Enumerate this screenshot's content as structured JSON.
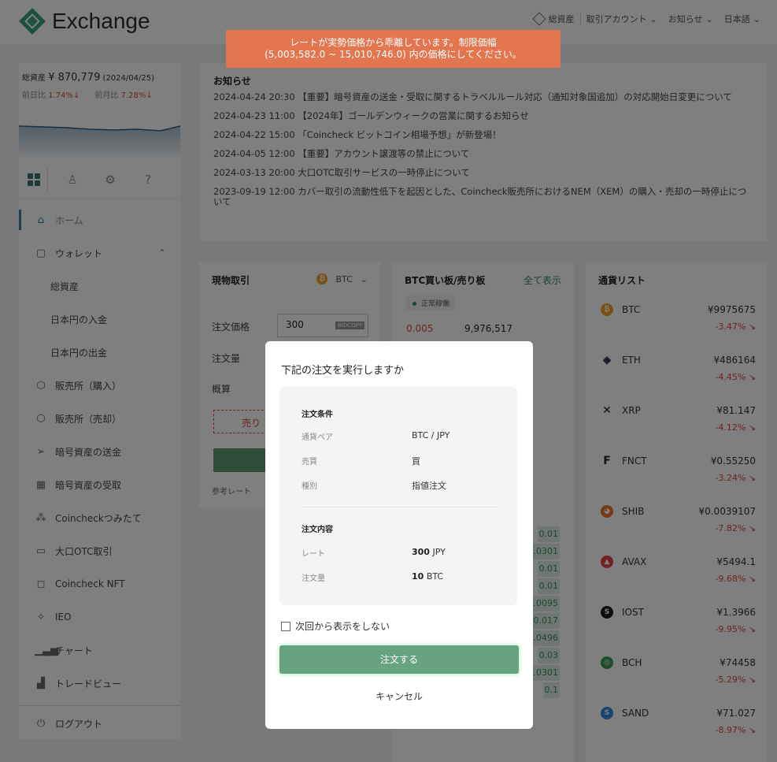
{
  "header": {
    "logo": "Exchange",
    "nav": [
      "総資産",
      "取引アカウント",
      "お知らせ",
      "日本語"
    ]
  },
  "toast": {
    "line1": "レートが実勢価格から乖離しています。制限価幅",
    "line2": "(5,003,582.0 ~ 15,010,746.0) 内の価格にしてください。"
  },
  "sidebar": {
    "total_label": "総資産",
    "total_value": "¥ 870,779",
    "total_date": "(2024/04/25)",
    "day_label": "前日比",
    "day_change": "1.74%↓",
    "month_label": "前月比",
    "month_change": "7.28%↓",
    "menu": [
      {
        "label": "ホーム"
      },
      {
        "label": "ウォレット"
      },
      {
        "label": "総資産"
      },
      {
        "label": "日本円の入金"
      },
      {
        "label": "日本円の出金"
      },
      {
        "label": "販売所（購入）"
      },
      {
        "label": "販売所（売却）"
      },
      {
        "label": "暗号資産の送金"
      },
      {
        "label": "暗号資産の受取"
      },
      {
        "label": "Coincheckつみたて"
      },
      {
        "label": "大口OTC取引"
      },
      {
        "label": "Coincheck NFT"
      },
      {
        "label": "IEO"
      },
      {
        "label": "チャート"
      },
      {
        "label": "トレードビュー"
      }
    ],
    "logout": "ログアウト"
  },
  "news": {
    "title": "お知らせ",
    "items": [
      "2024-04-24 20:30 【重要】暗号資産の送金・受取に関するトラベルルール対応（通知対象国追加）の対応開始日変更について",
      "2024-04-23 11:00 【2024年】ゴールデンウィークの営業に関するお知らせ",
      "2024-04-22 15:00 「Coincheck ビットコイン相場予想」が新登場！",
      "2024-04-05 12:00 【重要】アカウント譲渡等の禁止について",
      "2024-03-13 20:00 大口OTC取引サービスの一時停止について",
      "2023-09-19 12:00 カバー取引の流動性低下を起因とした、Coincheck販売所におけるNEM（XEM）の購入・売却の一時停止について"
    ]
  },
  "spot": {
    "title": "現物取引",
    "pair": "BTC",
    "price_label": "注文価格",
    "price_value": "300",
    "copy_label": "BIDCOPY",
    "qty_label": "注文量",
    "est_label": "概算",
    "sell_label": "売り",
    "ref_label": "参考レート"
  },
  "book": {
    "title": "BTC買い板/売り板",
    "show_all": "全て表示",
    "status": "正常稼働",
    "ask_size": "0.005",
    "ask_price": "9,976,517",
    "bids": [
      "0.01",
      "0.0301",
      "0.01",
      "0.01",
      "0.0095",
      "0.017",
      "0.0496",
      "0.03",
      "0.0301",
      "0.1"
    ]
  },
  "currency_list": {
    "title": "通貨リスト",
    "coins": [
      {
        "symbol": "BTC",
        "price": "¥9975675",
        "change": "-3.47%",
        "color": "#f4a329",
        "icon": "bitcoin-icon"
      },
      {
        "symbol": "ETH",
        "price": "¥486164",
        "change": "-4.45%",
        "color": "#3c3c5c",
        "icon": "ethereum-icon"
      },
      {
        "symbol": "XRP",
        "price": "¥81.147",
        "change": "-4.12%",
        "color": "#222222",
        "icon": "xrp-icon"
      },
      {
        "symbol": "FNCT",
        "price": "¥0.55250",
        "change": "-3.24%",
        "color": "#222222",
        "icon": "fnct-icon"
      },
      {
        "symbol": "SHIB",
        "price": "¥0.0039107",
        "change": "-7.82%",
        "color": "#e8742b",
        "icon": "shib-icon"
      },
      {
        "symbol": "AVAX",
        "price": "¥5494.1",
        "change": "-9.68%",
        "color": "#e84142",
        "icon": "avax-icon"
      },
      {
        "symbol": "IOST",
        "price": "¥1.3966",
        "change": "-9.95%",
        "color": "#1c1c1c",
        "icon": "iost-icon"
      },
      {
        "symbol": "BCH",
        "price": "¥74458",
        "change": "-5.29%",
        "color": "#3a9a5a",
        "icon": "bch-icon"
      },
      {
        "symbol": "SAND",
        "price": "¥71.027",
        "change": "-8.97%",
        "color": "#2f8ae0",
        "icon": "sand-icon"
      }
    ]
  },
  "modal": {
    "title": "下記の注文を実行しますか",
    "conditions_heading": "注文条件",
    "pair_label": "通貨ペア",
    "pair_value": "BTC / JPY",
    "side_label": "売買",
    "side_value": "買",
    "type_label": "種別",
    "type_value": "指値注文",
    "content_heading": "注文内容",
    "rate_label": "レート",
    "rate_value": "300",
    "rate_unit": "JPY",
    "qty_label": "注文量",
    "qty_value": "10",
    "qty_unit": "BTC",
    "checkbox_label": "次回から表示をしない",
    "submit_label": "注文する",
    "cancel_label": "キャンセル"
  },
  "colors": {
    "brand": "#3aa17a",
    "toast": "#e3764e",
    "down": "#d94a3a",
    "order_button": "#67a37f"
  }
}
